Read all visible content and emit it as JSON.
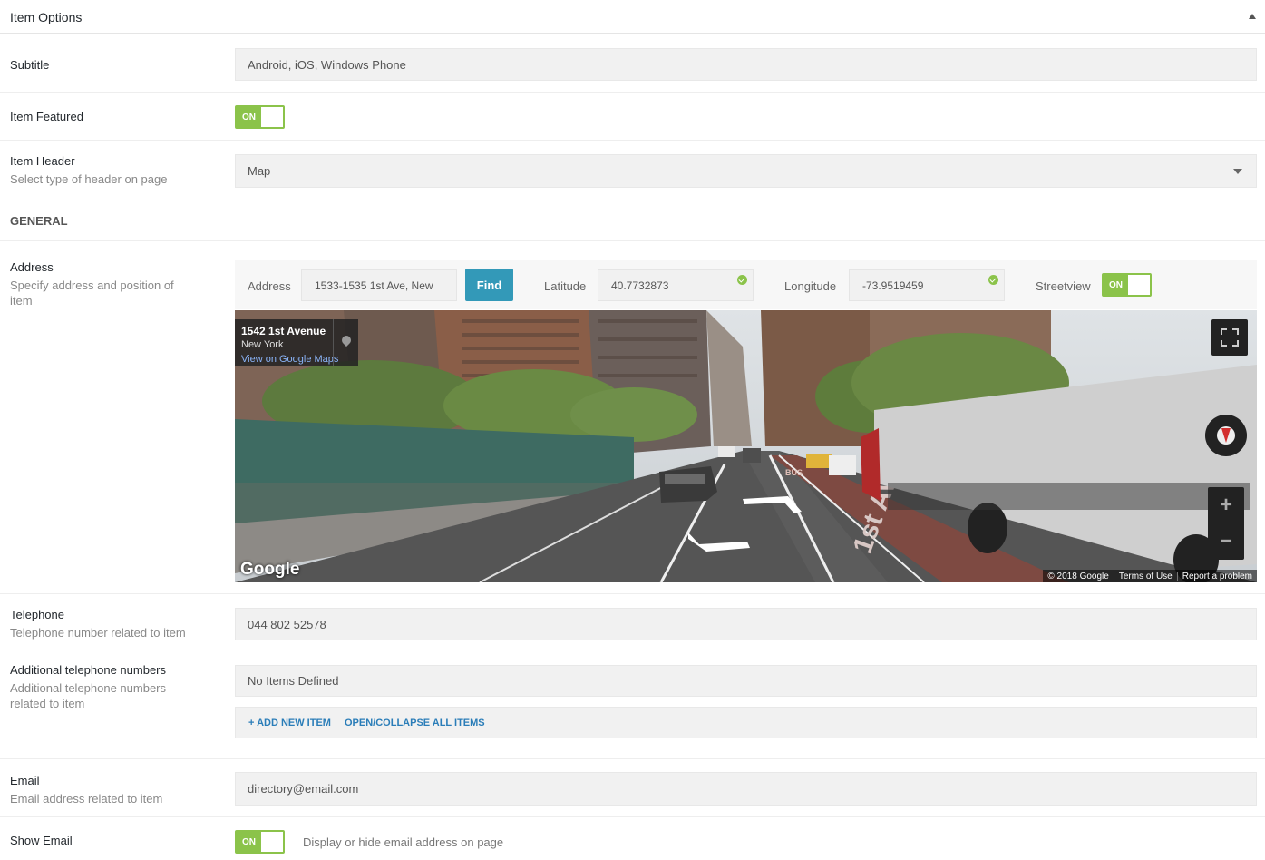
{
  "panel": {
    "title": "Item Options"
  },
  "subtitle": {
    "label": "Subtitle",
    "value": "Android, iOS, Windows Phone"
  },
  "featured": {
    "label": "Item Featured",
    "toggle": "ON"
  },
  "header": {
    "label": "Item Header",
    "desc": "Select type of header on page",
    "value": "Map"
  },
  "general": {
    "heading": "GENERAL"
  },
  "address": {
    "label": "Address",
    "desc": "Specify address and position of item",
    "address_label": "Address",
    "address_value": "1533-1535 1st Ave, New",
    "find_label": "Find",
    "lat_label": "Latitude",
    "lat_value": "40.7732873",
    "lng_label": "Longitude",
    "lng_value": "-73.9519459",
    "streetview_label": "Streetview",
    "streetview_toggle": "ON"
  },
  "map": {
    "place_title": "1542 1st Avenue",
    "place_city": "New York",
    "place_link": "View on Google Maps",
    "logo": "Google",
    "copyright": "© 2018 Google",
    "terms": "Terms of Use",
    "report": "Report a problem",
    "street_sign": "1st Ave",
    "road_marking": "BUS"
  },
  "telephone": {
    "label": "Telephone",
    "desc": "Telephone number related to item",
    "value": "044 802 52578"
  },
  "additional_phones": {
    "label": "Additional telephone numbers",
    "desc": "Additional telephone numbers related to item",
    "empty_text": "No Items Defined",
    "add_label": "+ ADD NEW ITEM",
    "collapse_label": "OPEN/COLLAPSE ALL ITEMS"
  },
  "email": {
    "label": "Email",
    "desc": "Email address related to item",
    "value": "directory@email.com"
  },
  "show_email": {
    "label": "Show Email",
    "toggle": "ON",
    "note": "Display or hide email address on page"
  },
  "colors": {
    "toggle_green": "#8bc34a",
    "find_button": "#3399b8",
    "link_blue": "#2a7db8"
  }
}
